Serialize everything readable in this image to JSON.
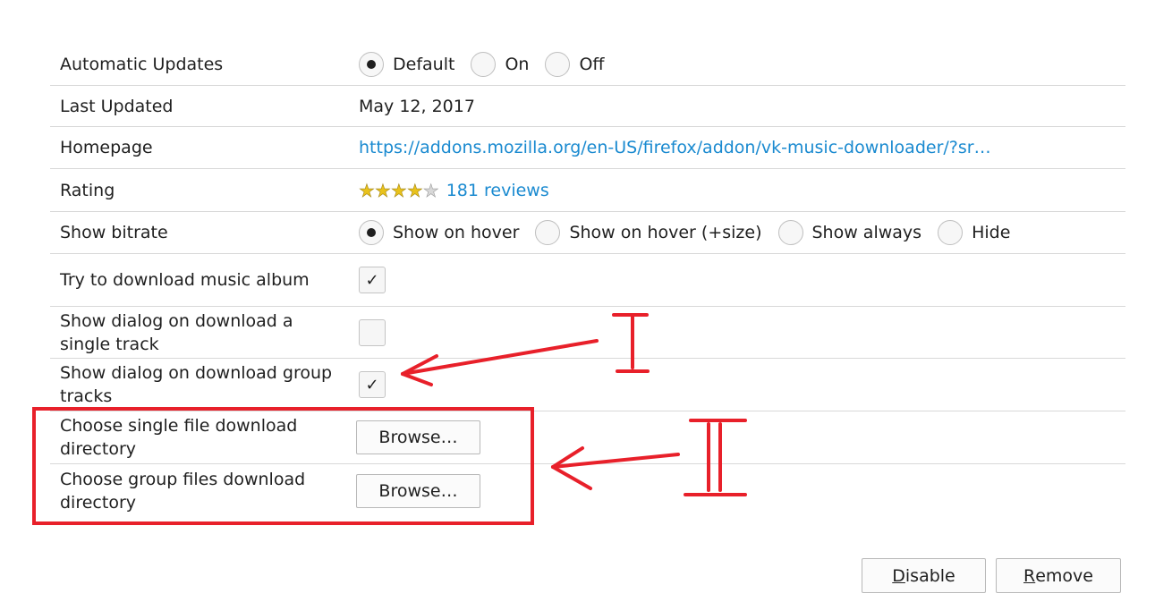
{
  "settings": {
    "auto_updates": {
      "label": "Automatic Updates",
      "options": [
        "Default",
        "On",
        "Off"
      ],
      "selected": "Default"
    },
    "last_updated": {
      "label": "Last Updated",
      "value": "May 12, 2017"
    },
    "homepage": {
      "label": "Homepage",
      "url": "https://addons.mozilla.org/en-US/firefox/addon/vk-music-downloader/?sr…"
    },
    "rating": {
      "label": "Rating",
      "stars": 4,
      "max_stars": 5,
      "reviews": "181 reviews"
    },
    "show_bitrate": {
      "label": "Show bitrate",
      "options": [
        "Show on hover",
        "Show on hover (+size)",
        "Show always",
        "Hide"
      ],
      "selected": "Show on hover"
    },
    "download_album": {
      "label": "Try to download music album",
      "checked": true
    },
    "dialog_single": {
      "label": "Show dialog on download a single track",
      "checked": false
    },
    "dialog_group": {
      "label": "Show dialog on download group tracks",
      "checked": true
    },
    "single_dir": {
      "label": "Choose single file download directory",
      "button": "Browse…"
    },
    "group_dir": {
      "label": "Choose group files download directory",
      "button": "Browse…"
    }
  },
  "footer": {
    "disable": {
      "mnemonic": "D",
      "rest": "isable"
    },
    "remove": {
      "mnemonic": "R",
      "rest": "emove"
    }
  },
  "annotations": {
    "mark_1": "I",
    "mark_2": "II",
    "color": "#e8202a"
  },
  "colors": {
    "link": "#1a8ad0",
    "star": "#e9c21b"
  }
}
